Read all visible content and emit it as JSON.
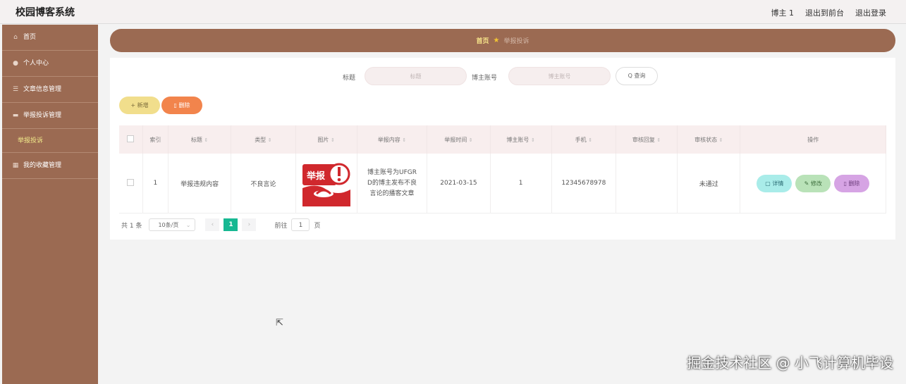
{
  "app": {
    "title": "校园博客系统"
  },
  "topbar": {
    "user": "博主 1",
    "exit_front": "退出到前台",
    "logout": "退出登录"
  },
  "sidebar": {
    "items": [
      {
        "label": "首页",
        "icon": "home-icon"
      },
      {
        "label": "个人中心",
        "icon": "user-icon"
      },
      {
        "label": "文章信息管理",
        "icon": "list-icon"
      },
      {
        "label": "举报投诉管理",
        "icon": "folder-icon"
      },
      {
        "label": "我的收藏管理",
        "icon": "grid-icon"
      }
    ],
    "submenu": {
      "label": "举报投诉"
    }
  },
  "breadcrumb": {
    "home": "首页",
    "current": "举报投诉"
  },
  "search": {
    "title_label": "标题",
    "title_placeholder": "标题",
    "account_label": "博主账号",
    "account_placeholder": "博主账号",
    "query_label": "Q 查询"
  },
  "toolbar": {
    "add_label": "+ 新增",
    "delete_label": "删除"
  },
  "table": {
    "columns": [
      "索引",
      "标题",
      "类型",
      "图片",
      "举报内容",
      "举报时间",
      "博主账号",
      "手机",
      "审核回复",
      "审核状态",
      "操作"
    ],
    "rows": [
      {
        "index": "1",
        "title": "举报违规内容",
        "type": "不良言论",
        "image_text": "举报",
        "content": "博主账号为UFGRD的博主发布不良言论的播客文章",
        "time": "2021-03-15",
        "account": "1",
        "phone": "12345678978",
        "reply": "",
        "status": "未通过",
        "actions": {
          "detail": "详情",
          "edit": "修改",
          "delete": "删除"
        }
      }
    ]
  },
  "pager": {
    "total": "共 1 条",
    "page_size": "10条/页",
    "current": "1",
    "goto_prefix": "前往",
    "goto_value": "1",
    "goto_suffix": "页"
  },
  "watermark": "掘金技术社区 @ 小飞计算机毕设",
  "colors": {
    "sidebar": "#9b6a52",
    "accent": "#17b892",
    "add": "#f1de8c",
    "delete": "#f2844c"
  }
}
